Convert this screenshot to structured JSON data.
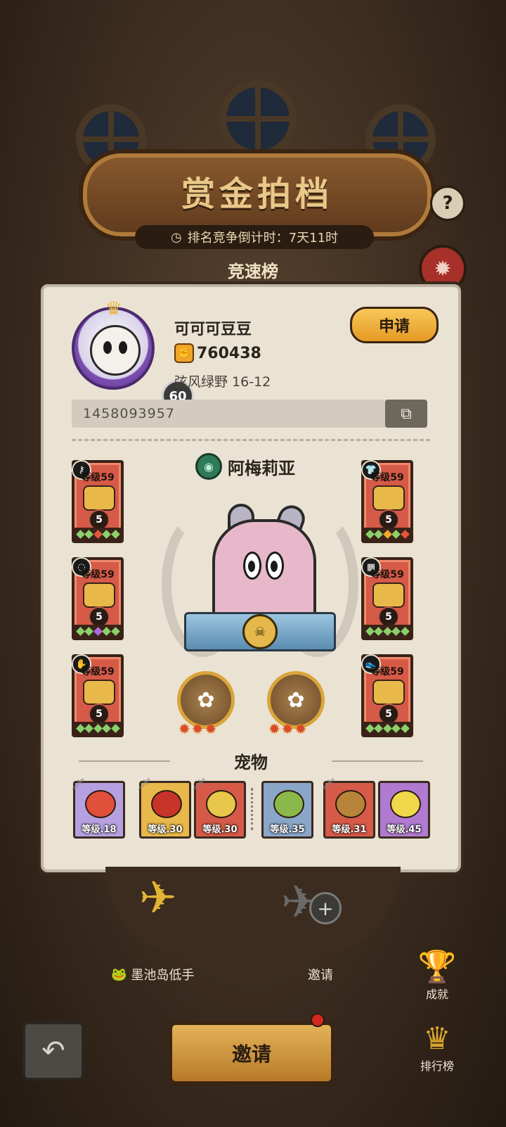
{
  "header": {
    "title": "赏金拍档",
    "countdown": "排名竞争倒计时：7天11时",
    "help_label": "?",
    "subtitle": "竞速榜"
  },
  "profile": {
    "name": "可可可豆豆",
    "level": "60",
    "power": "760438",
    "server": "弦风绿野 16-12",
    "apply_label": "申请",
    "player_id": "1458093957"
  },
  "hero": {
    "name": "阿梅莉亚"
  },
  "gear": [
    {
      "level": "等级59",
      "stars": "5",
      "type_icon": "key-icon",
      "gems": [
        "#8bd06a",
        "#8bd06a",
        "#e0573c",
        "#8bd06a",
        "#8bd06a"
      ]
    },
    {
      "level": "等级59",
      "stars": "5",
      "type_icon": "shirt-icon",
      "gems": [
        "#8bd06a",
        "#8bd06a",
        "#f0a52a",
        "#8bd06a",
        "#e0573c"
      ]
    },
    {
      "level": "等级59",
      "stars": "5",
      "type_icon": "ring-icon",
      "gems": [
        "#8bd06a",
        "#8bd06a",
        "#b06ae0",
        "#8bd06a",
        "#8bd06a"
      ]
    },
    {
      "level": "等级59",
      "stars": "5",
      "type_icon": "pants-icon",
      "gems": [
        "#8bd06a",
        "#8bd06a",
        "#8bd06a",
        "#8bd06a",
        "#8bd06a"
      ]
    },
    {
      "level": "等级59",
      "stars": "5",
      "type_icon": "glove-icon",
      "gems": [
        "#8bd06a",
        "#8bd06a",
        "#8bd06a",
        "#8bd06a",
        "#8bd06a"
      ]
    },
    {
      "level": "等级59",
      "stars": "5",
      "type_icon": "shoe-icon",
      "gems": [
        "#8bd06a",
        "#8bd06a",
        "#8bd06a",
        "#8bd06a",
        "#8bd06a"
      ]
    }
  ],
  "relics": [
    {
      "icon": "lily-icon",
      "stars": "3"
    },
    {
      "icon": "lily-icon",
      "stars": "3"
    }
  ],
  "pets": {
    "title": "宠物",
    "items": [
      {
        "level": "等级.18",
        "frame": "#b7a0e0"
      },
      {
        "level": "等级.30",
        "frame": "#e8b84a"
      },
      {
        "level": "等级.30",
        "frame": "#d65a48"
      },
      {
        "level": "等级.35",
        "frame": "#8aa6c8"
      },
      {
        "level": "等级.31",
        "frame": "#d65a48"
      },
      {
        "level": "等级.45",
        "frame": "#b07ad0"
      }
    ]
  },
  "lower": {
    "partner_name": "墨池岛低手",
    "invite_slot_label": "邀请",
    "invite_button": "邀请",
    "achievements_label": "成就",
    "leaderboard_label": "排行榜"
  },
  "colors": {
    "accent_gold": "#e59a22",
    "panel": "#eae2d3",
    "gear_card": "#d65a48"
  }
}
